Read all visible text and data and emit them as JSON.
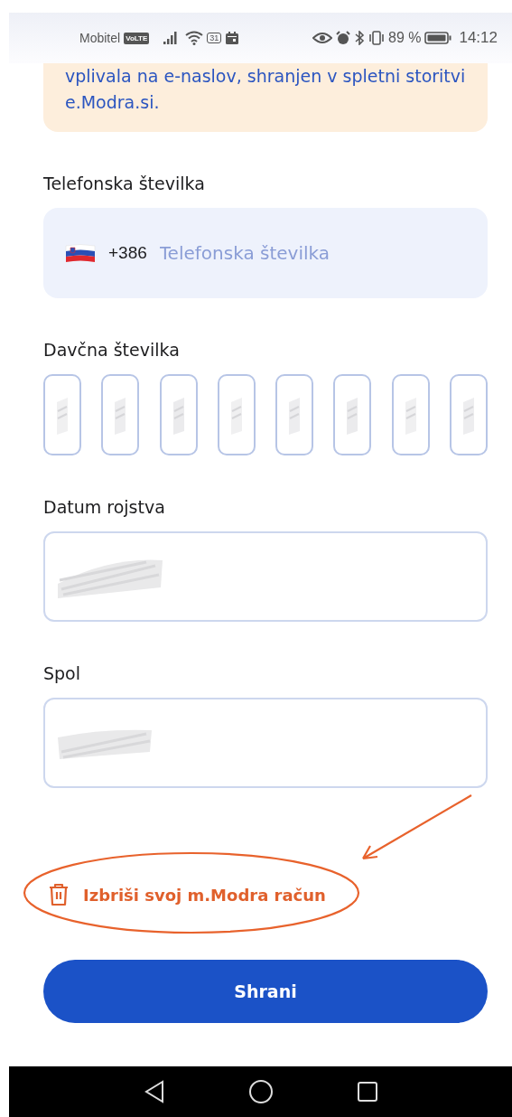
{
  "status_bar": {
    "carrier": "Mobitel",
    "network_badge": "VoLTE",
    "calendar_date": "31",
    "battery": "89 %",
    "time": "14:12"
  },
  "notice": {
    "text": "vplivala na e-naslov, shranjen v spletni storitvi e.Modra.si."
  },
  "form": {
    "phone": {
      "label": "Telefonska številka",
      "country_code": "+386",
      "placeholder": "Telefonska številka"
    },
    "tax_number": {
      "label": "Davčna številka",
      "boxes": [
        {
          "redacted": true
        },
        {
          "redacted": true
        },
        {
          "redacted": true
        },
        {
          "redacted": true
        },
        {
          "redacted": true
        },
        {
          "redacted": true
        },
        {
          "redacted": true
        },
        {
          "redacted": true
        }
      ]
    },
    "birth_date": {
      "label": "Datum rojstva",
      "redacted": true
    },
    "gender": {
      "label": "Spol",
      "redacted": true
    }
  },
  "delete_link": {
    "text": "Izbriši svoj m.Modra račun",
    "annotation": {
      "kind": "circled-with-arrow"
    }
  },
  "save_button": {
    "label": "Shrani"
  }
}
